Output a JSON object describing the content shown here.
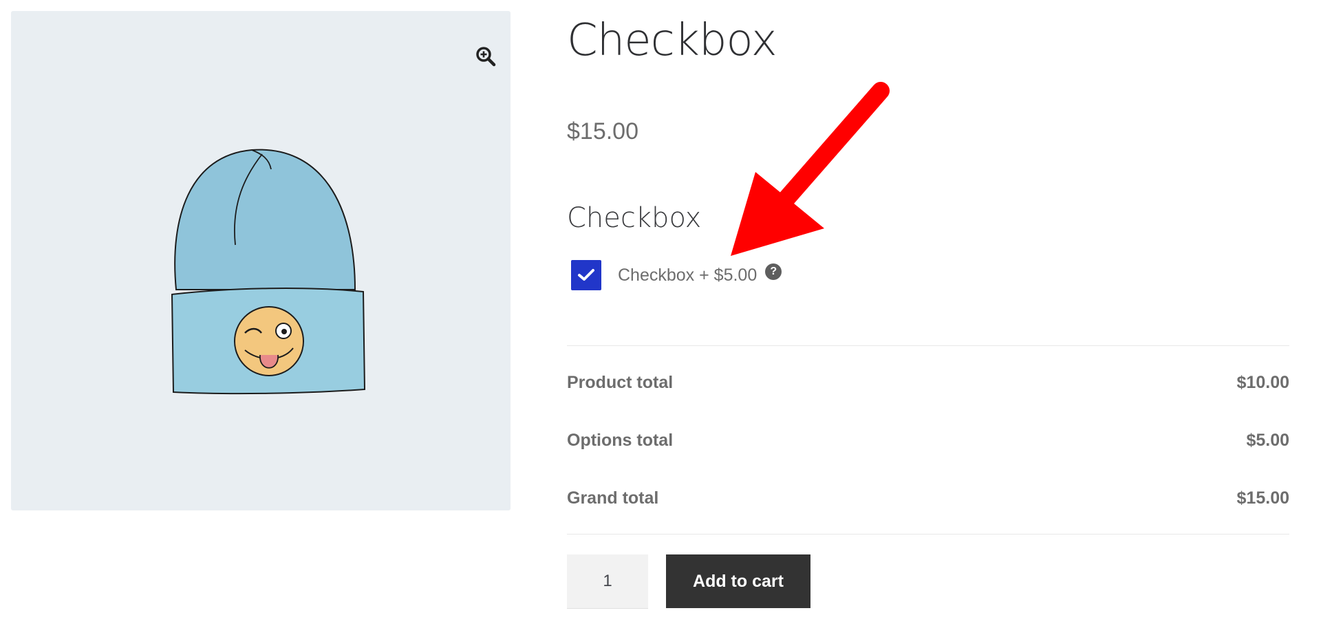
{
  "product": {
    "title": "Checkbox",
    "price": "$15.00"
  },
  "option": {
    "heading": "Checkbox",
    "label": "Checkbox + $5.00",
    "checked": true,
    "help_icon": "question-circle-icon"
  },
  "totals": [
    {
      "label": "Product total",
      "value": "$10.00"
    },
    {
      "label": "Options total",
      "value": "$5.00"
    },
    {
      "label": "Grand total",
      "value": "$15.00"
    }
  ],
  "cart": {
    "quantity": "1",
    "add_label": "Add to cart"
  },
  "icons": {
    "zoom": "zoom-in-icon",
    "check": "check-icon"
  },
  "colors": {
    "checkbox": "#2136c9",
    "annotation_arrow": "#ff0000",
    "button": "#333333",
    "image_bg": "#e9eef2"
  }
}
